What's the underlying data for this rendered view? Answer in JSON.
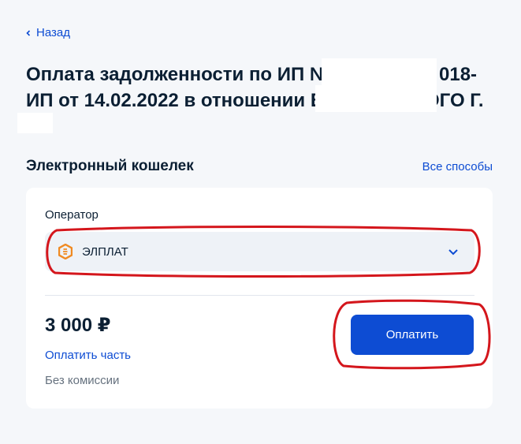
{
  "nav": {
    "back_label": "Назад"
  },
  "title": {
    "line1_part1": "Оплата задолженности по ИП №",
    "line1_part2": "018-",
    "line2_part1": "ИП от 14.02.2022 в отношении Б",
    "line2_part2": "ОГО Г."
  },
  "payment_method": {
    "section_title": "Электронный кошелек",
    "all_methods_label": "Все способы"
  },
  "operator": {
    "label": "Оператор",
    "selected_value": "ЭЛПЛАТ",
    "logo_icon": "elplat-logo-icon",
    "dropdown_icon": "chevron-down-icon"
  },
  "summary": {
    "amount": "3 000 ₽",
    "pay_part_label": "Оплатить часть",
    "fee_note": "Без комиссии",
    "pay_button_label": "Оплатить"
  },
  "colors": {
    "accent": "#0d4cd3",
    "annotation": "#d4161c",
    "logo": "#f08a22"
  }
}
